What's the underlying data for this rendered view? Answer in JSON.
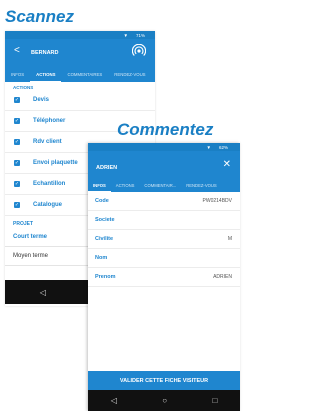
{
  "promos": {
    "scan": "Scannez",
    "comment": "Commentez"
  },
  "scan_screen": {
    "status": {
      "battery": "71%"
    },
    "header": {
      "title": "BERNARD",
      "back_icon": "back-arrow-icon",
      "nfc_icon": "nfc-icon"
    },
    "tabs": [
      {
        "label": "INFOS"
      },
      {
        "label": "ACTIONS"
      },
      {
        "label": "COMMENTAIRES"
      },
      {
        "label": "RENDEZ-VOUS"
      }
    ],
    "active_tab": "ACTIONS",
    "actions_heading": "ACTIONS",
    "actions": [
      {
        "label": "Devis",
        "checked": true
      },
      {
        "label": "Téléphoner",
        "checked": true
      },
      {
        "label": "Rdv client",
        "checked": true
      },
      {
        "label": "Envoi plaquette",
        "checked": true
      },
      {
        "label": "Echantillon",
        "checked": true
      },
      {
        "label": "Catalogue",
        "checked": true
      }
    ],
    "project_heading": "PROJET",
    "terms": [
      {
        "label": "Court terme",
        "selected": true
      },
      {
        "label": "Moyen terme",
        "selected": false
      }
    ],
    "nav": {
      "back": "◁",
      "home": "○"
    }
  },
  "comment_screen": {
    "status": {
      "battery": "62%"
    },
    "header": {
      "title": "ADRIEN",
      "close_icon": "close-icon"
    },
    "tabs": [
      {
        "label": "INFOS"
      },
      {
        "label": "ACTIONS"
      },
      {
        "label": "COMMENTAIR..."
      },
      {
        "label": "RENDEZ-VOUS"
      }
    ],
    "active_tab": "INFOS",
    "fields": [
      {
        "key": "Code",
        "value": "PW0214BDV"
      },
      {
        "key": "Societe",
        "value": ""
      },
      {
        "key": "Civilite",
        "value": "M"
      },
      {
        "key": "Nom",
        "value": ""
      },
      {
        "key": "Prenom",
        "value": "ADRIEN"
      }
    ],
    "validate_label": "VALIDER CETTE FICHE VISITEUR",
    "nav": {
      "back": "◁",
      "home": "○",
      "recent": "□"
    }
  }
}
